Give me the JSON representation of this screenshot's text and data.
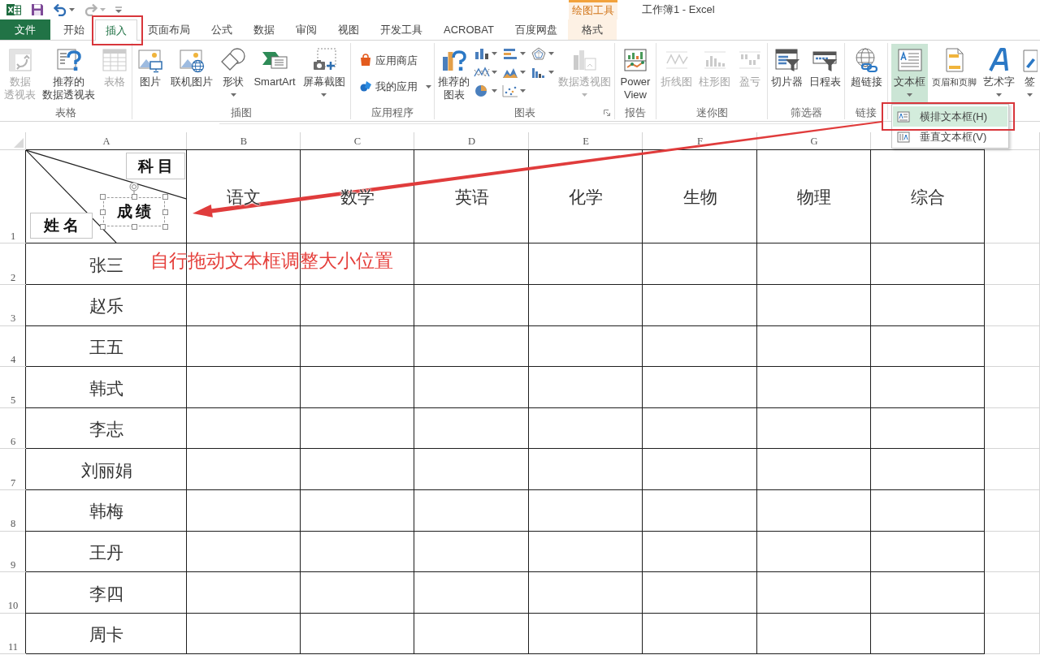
{
  "title_bar": {
    "quick_access": [
      {
        "disabled": false
      },
      {
        "disabled": false
      },
      {
        "disabled": true
      }
    ],
    "context_label": "绘图工具",
    "title": "工作簿1 - Excel"
  },
  "tabs": [
    {
      "label": "文件",
      "kind": "file",
      "selected": false
    },
    {
      "label": "开始",
      "kind": "normal",
      "selected": false
    },
    {
      "label": "插入",
      "kind": "normal",
      "selected": true
    },
    {
      "label": "页面布局",
      "kind": "normal",
      "selected": false
    },
    {
      "label": "公式",
      "kind": "normal",
      "selected": false
    },
    {
      "label": "数据",
      "kind": "normal",
      "selected": false
    },
    {
      "label": "审阅",
      "kind": "normal",
      "selected": false
    },
    {
      "label": "视图",
      "kind": "normal",
      "selected": false
    },
    {
      "label": "开发工具",
      "kind": "normal",
      "selected": false
    },
    {
      "label": "ACROBAT",
      "kind": "normal",
      "selected": false
    },
    {
      "label": "百度网盘",
      "kind": "normal",
      "selected": false
    },
    {
      "label": "格式",
      "kind": "context",
      "selected": false
    }
  ],
  "ribbon": {
    "groups": [
      {
        "label": "表格",
        "launcher": false,
        "items": [
          {
            "kind": "large",
            "lines": [
              "数据",
              "透视表"
            ],
            "disabled": true,
            "dropdown": false,
            "pressed": false
          },
          {
            "kind": "large",
            "lines": [
              "推荐的",
              "数据透视表"
            ],
            "disabled": false,
            "dropdown": false,
            "pressed": false
          },
          {
            "kind": "large",
            "label": "表格",
            "disabled": true,
            "dropdown": false,
            "pressed": false
          }
        ]
      },
      {
        "label": "插图",
        "launcher": false,
        "items": [
          {
            "kind": "large",
            "label": "图片",
            "disabled": false,
            "dropdown": false,
            "pressed": false
          },
          {
            "kind": "large",
            "label": "联机图片",
            "disabled": false,
            "dropdown": false,
            "pressed": false
          },
          {
            "kind": "large",
            "label": "形状",
            "disabled": false,
            "dropdown": true,
            "pressed": false
          },
          {
            "kind": "large",
            "label": "SmartArt",
            "disabled": false,
            "dropdown": false,
            "pressed": false
          },
          {
            "kind": "large",
            "label": "屏幕截图",
            "disabled": false,
            "dropdown": true,
            "pressed": false
          }
        ]
      },
      {
        "label": "应用程序",
        "launcher": false,
        "items": [
          {
            "kind": "small",
            "label": "应用商店",
            "disabled": false,
            "dropdown": false,
            "pressed": false
          },
          {
            "kind": "small",
            "label": "我的应用",
            "disabled": false,
            "dropdown": true,
            "pressed": false
          }
        ]
      },
      {
        "label": "图表",
        "launcher": true,
        "items": [
          {
            "kind": "large",
            "lines": [
              "推荐的",
              "图表"
            ],
            "disabled": false,
            "dropdown": false,
            "pressed": false
          },
          {
            "kind": "gallery",
            "buttons": [
              {
                "dropdown": true
              },
              {
                "dropdown": true
              },
              {
                "dropdown": true
              },
              {
                "dropdown": true
              },
              {
                "dropdown": true
              },
              {
                "dropdown": true
              },
              {
                "dropdown": true
              },
              {
                "dropdown": true
              }
            ]
          },
          {
            "kind": "large",
            "label": "数据透视图",
            "disabled": true,
            "dropdown": true,
            "pressed": false
          }
        ]
      },
      {
        "label": "报告",
        "launcher": false,
        "items": [
          {
            "kind": "large",
            "label": "Power\nView",
            "disabled": false,
            "dropdown": false,
            "pressed": false
          }
        ]
      },
      {
        "label": "迷你图",
        "launcher": false,
        "items": [
          {
            "kind": "large",
            "label": "折线图",
            "disabled": true,
            "dropdown": false,
            "pressed": false
          },
          {
            "kind": "large",
            "label": "柱形图",
            "disabled": true,
            "dropdown": false,
            "pressed": false
          },
          {
            "kind": "large",
            "label": "盈亏",
            "disabled": true,
            "dropdown": false,
            "pressed": false
          }
        ]
      },
      {
        "label": "筛选器",
        "launcher": false,
        "items": [
          {
            "kind": "large",
            "label": "切片器",
            "disabled": false,
            "dropdown": false,
            "pressed": false
          },
          {
            "kind": "large",
            "label": "日程表",
            "disabled": false,
            "dropdown": false,
            "pressed": false
          }
        ]
      },
      {
        "label": "链接",
        "launcher": false,
        "items": [
          {
            "kind": "large",
            "label": "超链接",
            "disabled": false,
            "dropdown": false,
            "pressed": false
          }
        ]
      },
      {
        "launcher": false,
        "items": [
          {
            "kind": "large",
            "label": "文本框",
            "disabled": false,
            "dropdown": true,
            "pressed": true
          },
          {
            "kind": "large",
            "label": "页眉和页脚",
            "disabled": false,
            "dropdown": false,
            "pressed": false
          },
          {
            "kind": "large",
            "label": "艺术字",
            "disabled": false,
            "dropdown": true,
            "pressed": false
          },
          {
            "kind": "large",
            "label": "签",
            "disabled": false,
            "dropdown": true,
            "pressed": false
          }
        ]
      }
    ]
  },
  "textbox_menu": {
    "items": [
      {
        "label": "横排文本框(H)",
        "selected": true
      },
      {
        "label": "垂直文本框(V)",
        "selected": false
      }
    ]
  },
  "sheet": {
    "column_headers": [
      "A",
      "B",
      "C",
      "D",
      "E",
      "F",
      "G"
    ],
    "row_numbers": [
      "1",
      "2",
      "3",
      "4",
      "5",
      "6",
      "7",
      "8",
      "9",
      "10",
      "11"
    ],
    "header_cell": {
      "text_boxes": [
        {
          "text": "科 目",
          "selected": false
        },
        {
          "text": "成 绩",
          "selected": true
        },
        {
          "text": "姓 名",
          "selected": false
        }
      ]
    },
    "subjects": [
      "语文",
      "数学",
      "英语",
      "化学",
      "生物",
      "物理",
      "综合"
    ],
    "names": [
      "张三",
      "赵乐",
      "王五",
      "韩式",
      "李志",
      "刘丽娟",
      "韩梅",
      "王丹",
      "李四",
      "周卡"
    ]
  },
  "annotation": {
    "text": "自行拖动文本框调整大小位置"
  }
}
